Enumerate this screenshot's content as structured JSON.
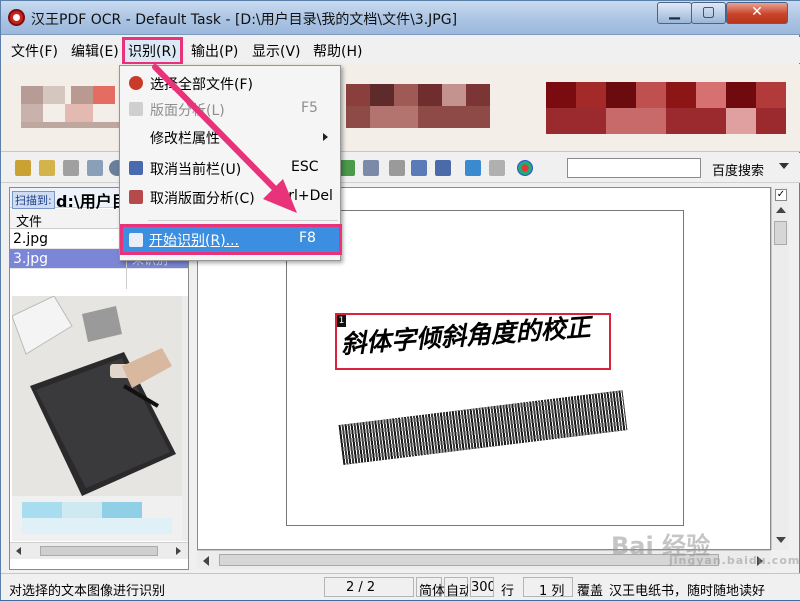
{
  "window": {
    "title": "汉王PDF OCR - Default Task - [D:\\用户目录\\我的文档\\文件\\3.JPG]",
    "minimize_glyph": "▁",
    "maximize_glyph": "▢",
    "close_glyph": "✕"
  },
  "menubar": {
    "items": [
      "文件(F)",
      "编辑(E)",
      "识别(R)",
      "输出(P)",
      "显示(V)",
      "帮助(H)"
    ],
    "active_index": 2
  },
  "recognize_menu": {
    "items": [
      {
        "label": "选择全部文件(F)",
        "shortcut": "",
        "enabled": true,
        "icon": "select-all-icon"
      },
      {
        "label": "版面分析(L)",
        "shortcut": "F5",
        "enabled": false,
        "icon": "layout-analysis-icon"
      },
      {
        "label": "修改栏属性",
        "shortcut": "",
        "enabled": true,
        "submenu": true
      },
      {
        "label": "取消当前栏(U)",
        "shortcut": "ESC",
        "enabled": true,
        "icon": "cancel-column-icon"
      },
      {
        "label": "取消版面分析(C)",
        "shortcut": "Ctrl+Del",
        "enabled": true,
        "icon": "cancel-layout-icon"
      },
      {
        "label": "开始识别(R)...",
        "shortcut": "F8",
        "enabled": true,
        "highlighted": true,
        "icon": "start-recognize-icon"
      }
    ]
  },
  "toolbar": {
    "search_value": "",
    "search_engine": "百度搜索"
  },
  "file_panel": {
    "scan_tag": "扫描到:",
    "scan_path": "d:\\用户目",
    "column_header": "文件",
    "files": [
      {
        "name": "2.jpg",
        "status": ""
      },
      {
        "name": "3.jpg",
        "status": "未识别",
        "selected": true
      }
    ]
  },
  "document": {
    "region_number": "1",
    "region_text": "斜体字倾斜角度的校正"
  },
  "statusbar": {
    "hint": "对选择的文本图像进行识别",
    "page": "2 / 2",
    "lang": "简体",
    "mode": "自动",
    "dpi": "300",
    "row_label": "行",
    "col_value": "1 列",
    "overwrite": "覆盖",
    "marquee": "汉王电纸书，随时随地读好"
  },
  "watermark": {
    "text": "Bai 经验",
    "sub": "jingyan.baidu.com"
  },
  "colors": {
    "highlight_pink": "#e8327a",
    "menu_selection": "#3c8fe0",
    "file_selected": "#7b86d6",
    "region_border": "#d8243a"
  }
}
